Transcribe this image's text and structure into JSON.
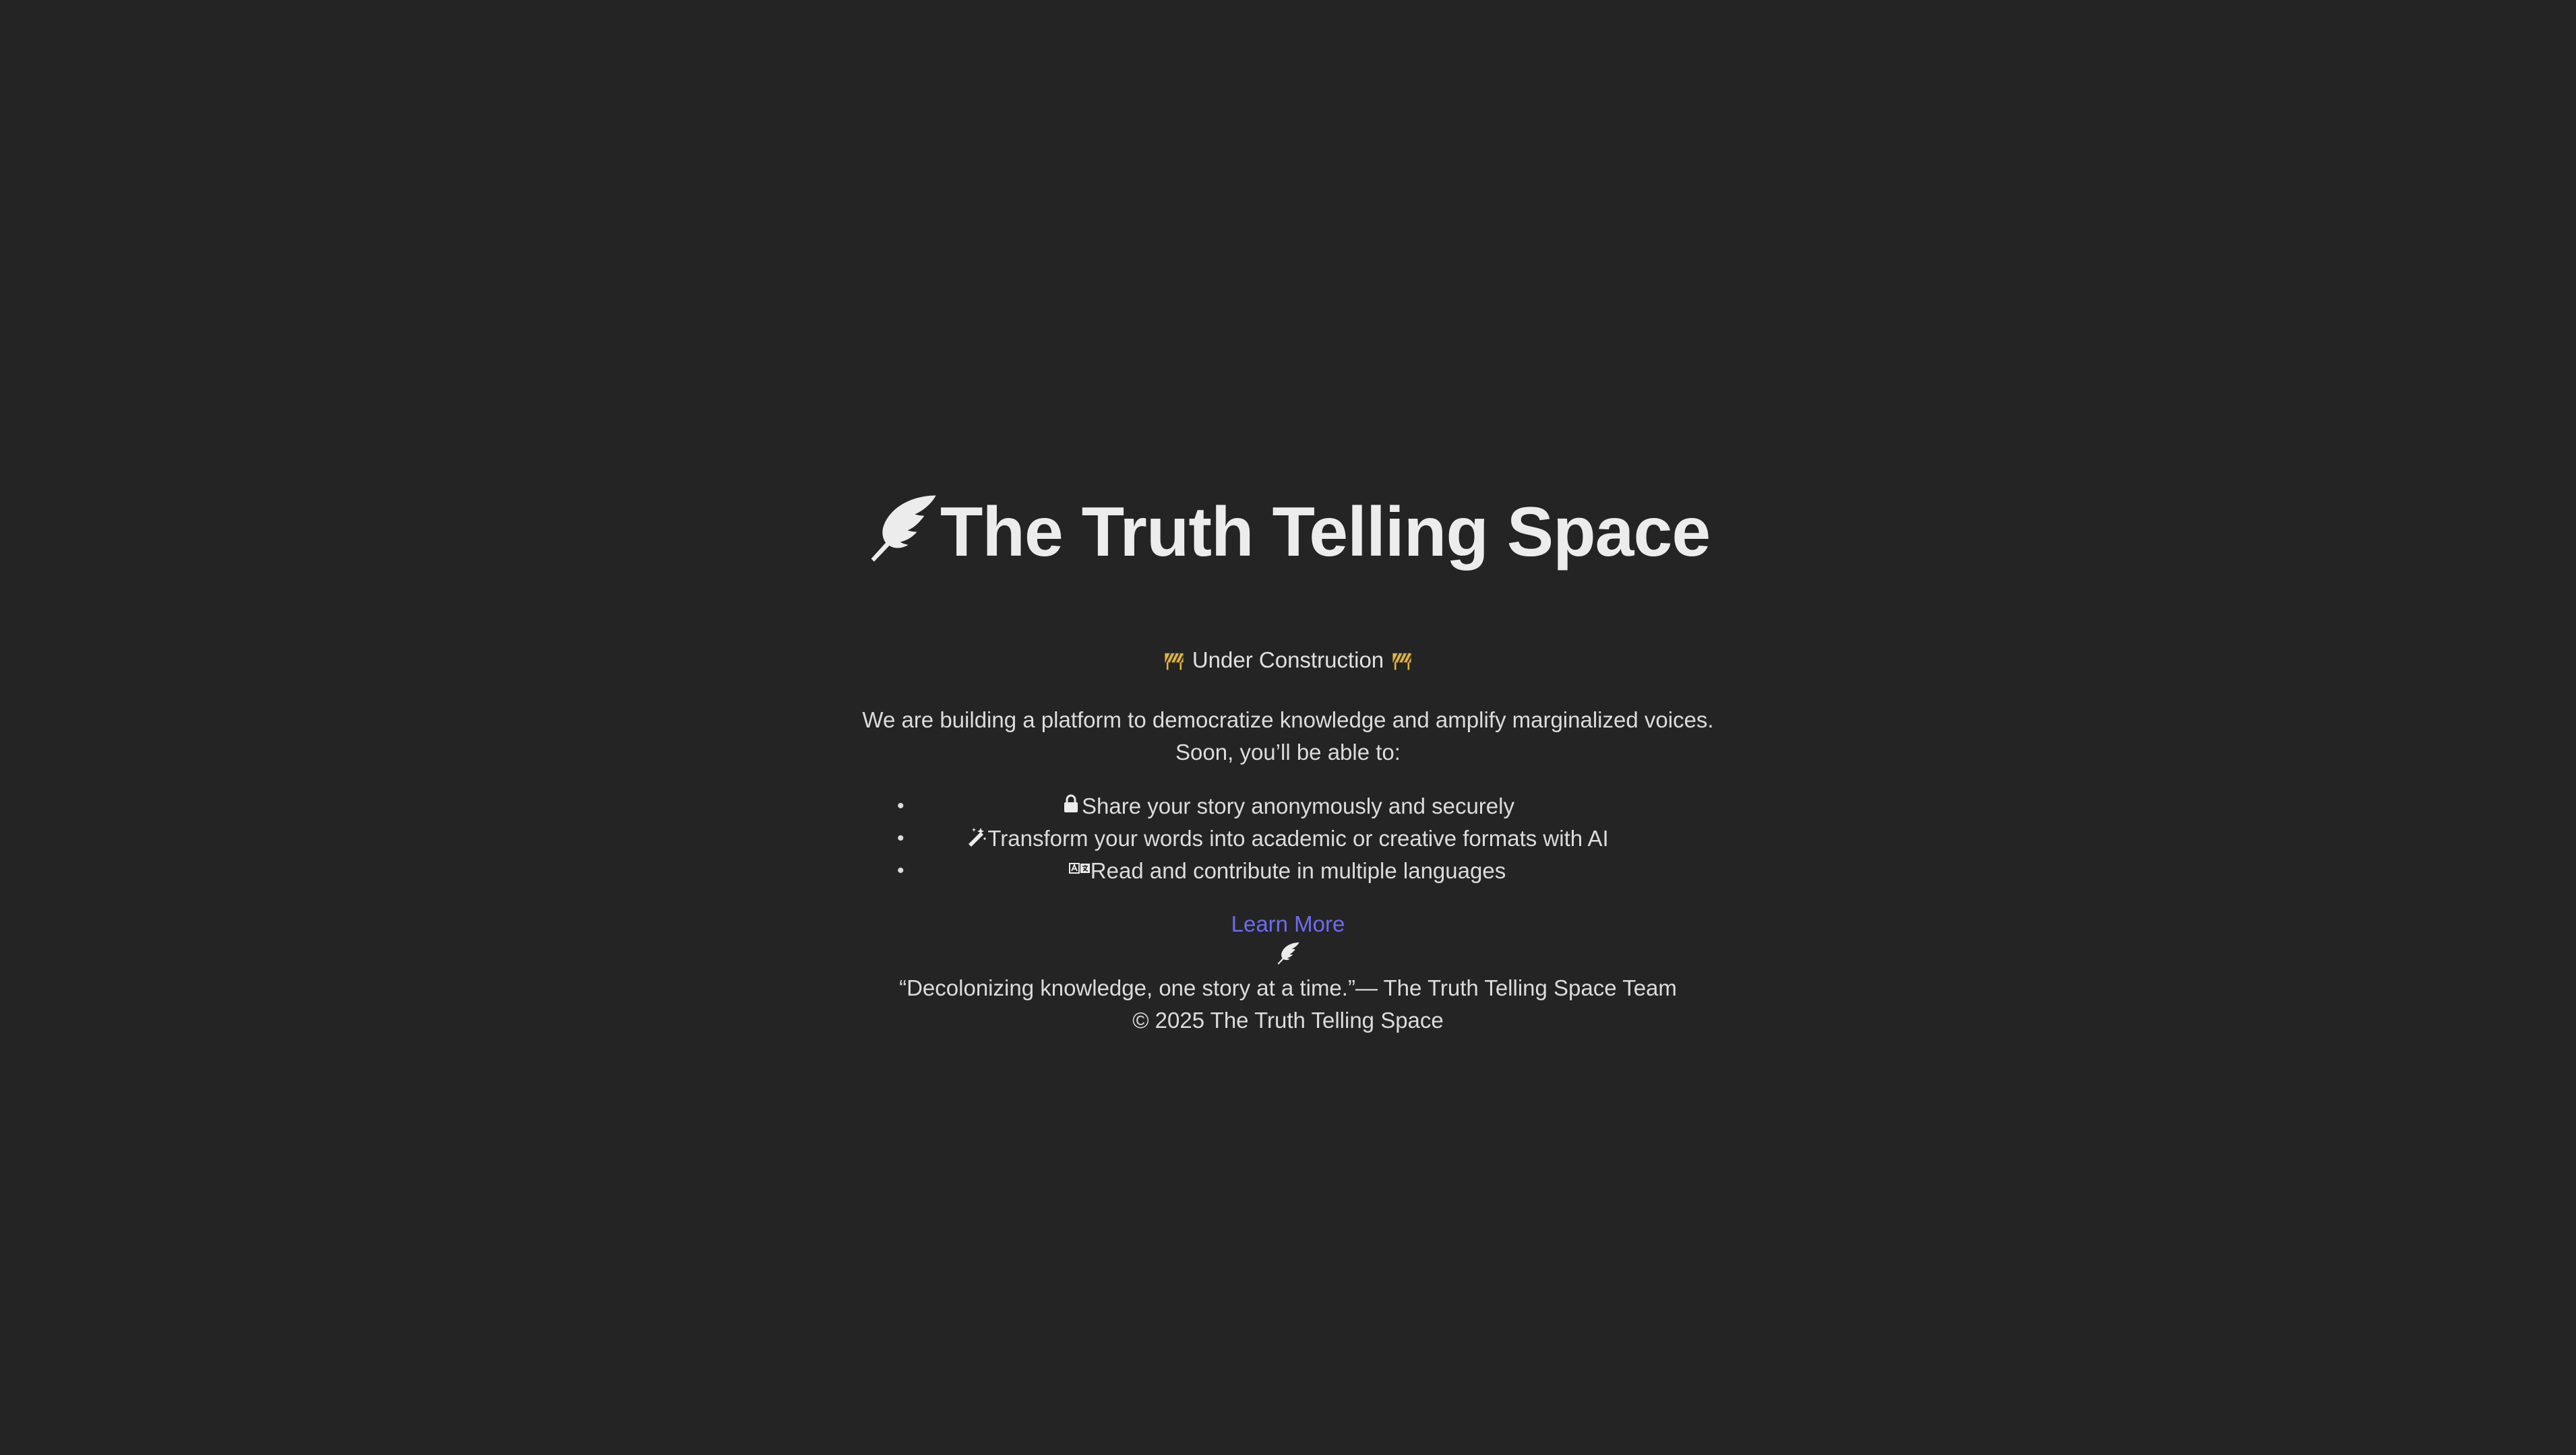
{
  "header": {
    "title": "The Truth Telling Space"
  },
  "status": {
    "label": "Under Construction",
    "icon": "construction-barrier-icon"
  },
  "description": {
    "line1": "We are building a platform to democratize knowledge and amplify marginalized voices.",
    "line2": "Soon, you’ll be able to:"
  },
  "features": [
    {
      "icon": "lock-icon",
      "text": "Share your story anonymously and securely"
    },
    {
      "icon": "magic-wand-icon",
      "text": "Transform your words into academic or creative formats with AI"
    },
    {
      "icon": "language-icon",
      "text": "Read and contribute in multiple languages"
    }
  ],
  "learn_more": {
    "label": "Learn More"
  },
  "footer": {
    "quote": "“Decolonizing knowledge, one story at a time.”— The Truth Telling Space Team",
    "copyright": "© 2025 The Truth Telling Space"
  },
  "colors": {
    "background": "#242424",
    "text": "#e8e8e8",
    "link": "#6b6cf0",
    "barrier": "#e5b53a"
  }
}
